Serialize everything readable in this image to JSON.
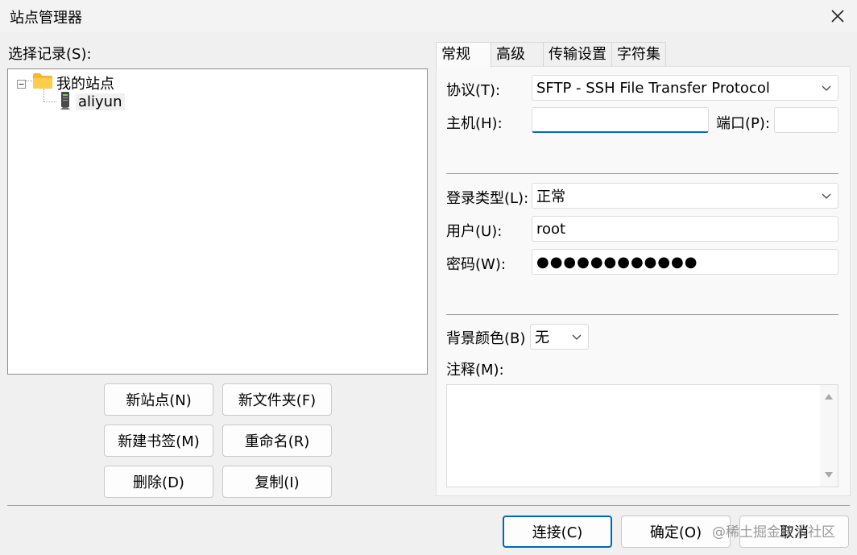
{
  "window": {
    "title": "站点管理器"
  },
  "left": {
    "section_label": "选择记录(S):",
    "tree": {
      "root_label": "我的站点",
      "children": [
        {
          "label": "aliyun"
        }
      ]
    },
    "buttons": {
      "new_site": "新站点(N)",
      "new_folder": "新文件夹(F)",
      "new_bookmark": "新建书签(M)",
      "rename": "重命名(R)",
      "delete": "删除(D)",
      "copy": "复制(I)"
    }
  },
  "tabs": [
    "常规",
    "高级",
    "传输设置",
    "字符集"
  ],
  "general": {
    "protocol_label": "协议(T):",
    "protocol_value": "SFTP - SSH File Transfer Protocol",
    "host_label": "主机(H):",
    "host_value": "",
    "port_label": "端口(P):",
    "port_value": "",
    "logon_type_label": "登录类型(L):",
    "logon_type_value": "正常",
    "user_label": "用户(U):",
    "user_value": "root",
    "password_label": "密码(W):",
    "password_value": "●●●●●●●●●●●●",
    "bg_color_label": "背景颜色(B)",
    "bg_color_value": "无",
    "comments_label": "注释(M):",
    "comments_value": ""
  },
  "footer": {
    "connect": "连接(C)",
    "ok": "确定(O)",
    "cancel": "取消"
  },
  "watermark": "@稀土掘金技术社区",
  "colors": {
    "accent": "#0067c0",
    "folder": "#f5b731"
  }
}
